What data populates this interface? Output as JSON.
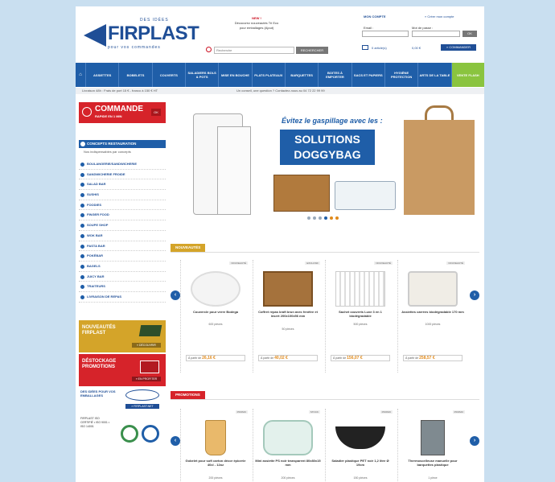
{
  "header": {
    "logo_top": "DES IDÉES",
    "logo_name": "FIRPLAST",
    "logo_sub": "pour vos commandes",
    "promo_new": "NEW !",
    "promo_line1": "Découvrez nouveautés Tri Eco",
    "promo_line2": "pour emballages (Ajout)",
    "search_placeholder": "Recherche",
    "search_button": "RECHERCHER",
    "account_link": "MON COMPTE",
    "create_link": "» Créer mon compte",
    "email_label": "Email :",
    "password_label": "Mot de passe :",
    "ok_label": "OK",
    "cart_label": "0 article(s)",
    "cart_amount": "0,00 €",
    "order_button": "» COMMANDER"
  },
  "nav": {
    "items": [
      {
        "label": "ASSIETTES"
      },
      {
        "label": "BOBELETS"
      },
      {
        "label": "COUVERTS"
      },
      {
        "label": "SALADIERS BOLS & POTS"
      },
      {
        "label": "MISE EN BOUCHE"
      },
      {
        "label": "PLATS PLATEAUX"
      },
      {
        "label": "BARQUETTES"
      },
      {
        "label": "BOITES À EMPORTER"
      },
      {
        "label": "SACS ET PAPIERS"
      },
      {
        "label": "HYGIÈNE PROTECTION"
      },
      {
        "label": "ARTS DE LA TABLE"
      },
      {
        "label": "VENTE FLASH"
      }
    ]
  },
  "infobar": {
    "left": "Livraison 48h : Frais de port 15 € - franco à 150 € HT",
    "right": "Un conseil, une question ? Contactez-nous au 04 72 22 99 99"
  },
  "sidebar": {
    "commande_title": "COMMANDE",
    "commande_sub": "RAPIDE EN 1 MIN",
    "commande_ok": "OK",
    "concepts_title": "CONCEPTS RESTAURATION",
    "concepts_desc": "Nos indispensables par concepts",
    "concepts": [
      "BOULANGERIE/SANDWICHERIE",
      "SANDWICHERIE FROIDE",
      "SALAD BAR",
      "SUSHIS",
      "FOODIES",
      "FINGER FOOD",
      "SOUPE SHOP",
      "WOK BAR",
      "PASTA BAR",
      "POKÉBAR",
      "BAGELS",
      "JUICY BAR",
      "TRAITEURS",
      "LIVRAISON DE REPAS"
    ],
    "banner1_title": "NOUVEAUTÉS FIRPLAST",
    "banner1_btn": "» DÉCOUVRIR",
    "banner2_title": "DÉSTOCKAGE PROMOTIONS",
    "banner2_btn": "» EN PROFITER",
    "partners_text": "DES IDÉES POUR VOS EMBALLAGES",
    "partners_btn": "» FIRPLAST.NET",
    "iso_text": "FIRPLAST ISO CERTIFIÉ • ISO 9001 • ISO 14001"
  },
  "hero": {
    "tagline": "Évitez le gaspillage avec les :",
    "title_line1": "SOLUTIONS",
    "title_line2": "DOGGYBAG",
    "dots": 6,
    "active_dot": 3
  },
  "sections": {
    "nouveautes": {
      "label": "NOUVEAUTÉS",
      "color": "#d4a429",
      "products": [
        {
          "tag": "NOUVEAUTÉ",
          "name": "Couvercle pour verre Bodega",
          "qty": "600 pièces",
          "price_label": "À partir de",
          "price": "26,16 €"
        },
        {
          "tag": "EXCLUSIF",
          "name": "Coffret repas kraft brun avec fenêtre et insert 200x100x56 mm",
          "qty": "50 pièces",
          "price_label": "À partir de",
          "price": "40,02 €"
        },
        {
          "tag": "NOUVEAUTÉ",
          "name": "Sachet couverts Luxe 3 en 1 biodégradable",
          "qty": "500 pièces",
          "price_label": "À partir de",
          "price": "156,07 €"
        },
        {
          "tag": "NOUVEAUTÉ",
          "name": "Assiettes carrées biodégradable 170 mm",
          "qty": "1000 pièces",
          "price_label": "À partir de",
          "price": "258,57 €"
        }
      ]
    },
    "promotions": {
      "label": "PROMOTIONS",
      "color": "#d6232a",
      "products": [
        {
          "tag": "PROMO",
          "name": "Gobelet pour soft carton décor épicerie 40cl - 12oz",
          "qty": "200 pièces"
        },
        {
          "tag": "STOCK",
          "name": "Mini assiette PS noir transparent 80x80x15 mm",
          "qty": "200 pièces"
        },
        {
          "tag": "PROMO",
          "name": "Saladier plastique PET noir 1,2 litre Ø 19cm",
          "qty": "150 pièces"
        },
        {
          "tag": "PROMO",
          "name": "Thermoscelleuse manuelle pour barquettes plastique",
          "qty": "1 pièce"
        }
      ]
    }
  }
}
